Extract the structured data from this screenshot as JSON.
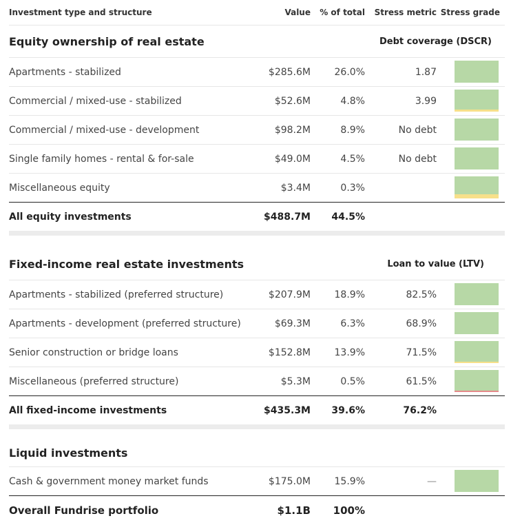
{
  "header": {
    "name": "Investment type and structure",
    "value": "Value",
    "pct": "% of total",
    "metric": "Stress metric",
    "grade": "Stress grade"
  },
  "equity": {
    "title": "Equity ownership of real estate",
    "metric_title": "Debt coverage (DSCR)",
    "rows": [
      {
        "name": "Apartments - stabilized",
        "value": "$285.6M",
        "pct": "26.0%",
        "metric": "1.87"
      },
      {
        "name": "Commercial / mixed-use - stabilized",
        "value": "$52.6M",
        "pct": "4.8%",
        "metric": "3.99"
      },
      {
        "name": "Commercial / mixed-use - development",
        "value": "$98.2M",
        "pct": "8.9%",
        "metric": "No debt"
      },
      {
        "name": "Single family homes - rental & for-sale",
        "value": "$49.0M",
        "pct": "4.5%",
        "metric": "No debt"
      },
      {
        "name": "Miscellaneous equity",
        "value": "$3.4M",
        "pct": "0.3%",
        "metric": ""
      }
    ],
    "total": {
      "name": "All equity investments",
      "value": "$488.7M",
      "pct": "44.5%",
      "metric": ""
    }
  },
  "fixed": {
    "title": "Fixed-income real estate investments",
    "metric_title": "Loan to value (LTV)",
    "rows": [
      {
        "name": "Apartments - stabilized (preferred structure)",
        "value": "$207.9M",
        "pct": "18.9%",
        "metric": "82.5%"
      },
      {
        "name": "Apartments - development (preferred structure)",
        "value": "$69.3M",
        "pct": "6.3%",
        "metric": "68.9%"
      },
      {
        "name": "Senior construction or bridge loans",
        "value": "$152.8M",
        "pct": "13.9%",
        "metric": "71.5%"
      },
      {
        "name": "Miscellaneous (preferred structure)",
        "value": "$5.3M",
        "pct": "0.5%",
        "metric": "61.5%"
      }
    ],
    "total": {
      "name": "All fixed-income investments",
      "value": "$435.3M",
      "pct": "39.6%",
      "metric": "76.2%"
    }
  },
  "liquid": {
    "title": "Liquid investments",
    "rows": [
      {
        "name": "Cash & government money market funds",
        "value": "$175.0M",
        "pct": "15.9%",
        "metric": "—"
      }
    ]
  },
  "overall": {
    "name": "Overall Fundrise portfolio",
    "value": "$1.1B",
    "pct": "100%"
  },
  "colors": {
    "grade_green": "#b7d8a6",
    "grade_yellow": "#f7e08a",
    "grade_red": "#e58a8a"
  }
}
